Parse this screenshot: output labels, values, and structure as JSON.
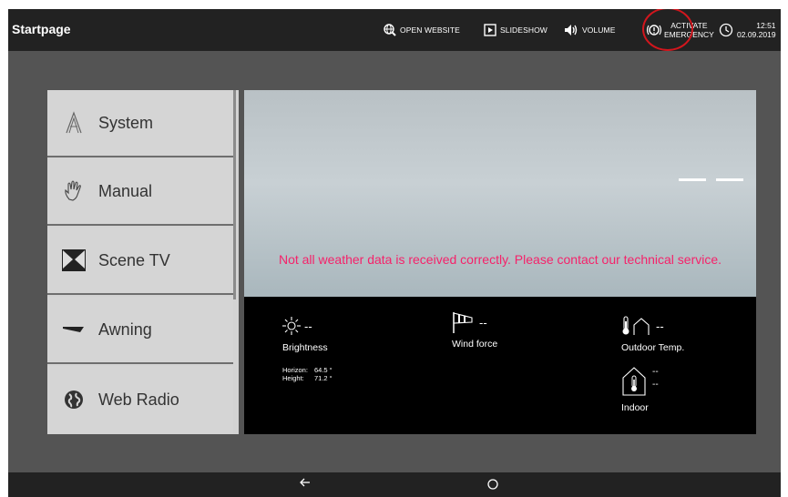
{
  "header": {
    "title": "Startpage",
    "open_website": "OPEN WEBSITE",
    "slideshow": "SLIDESHOW",
    "volume": "VOLUME",
    "emergency_line1": "ACTIVATE",
    "emergency_line2": "EMERGENCY",
    "time": "12:51",
    "date": "02.09.2019"
  },
  "menu": {
    "items": [
      {
        "label": "System",
        "icon": "system-icon"
      },
      {
        "label": "Manual",
        "icon": "hand-icon"
      },
      {
        "label": "Scene TV",
        "icon": "scene-icon"
      },
      {
        "label": "Awning",
        "icon": "awning-icon"
      },
      {
        "label": "Web Radio",
        "icon": "globe-icon"
      }
    ]
  },
  "weather": {
    "error_message": "Not all weather data is received correctly. Please contact our technical service.",
    "brightness": {
      "value": "--",
      "label": "Brightness"
    },
    "horizon": {
      "label": "Horizon:",
      "value": "64.5 °"
    },
    "height": {
      "label": "Height:",
      "value": "71.2 °"
    },
    "wind": {
      "value": "--",
      "label": "Wind force"
    },
    "outdoor": {
      "value": "--",
      "label": "Outdoor Temp."
    },
    "indoor": {
      "value1": "--",
      "value2": "--",
      "label": "Indoor"
    }
  },
  "colors": {
    "error": "#f5226a",
    "highlight_circle": "#d2161d",
    "bar": "#222222"
  }
}
